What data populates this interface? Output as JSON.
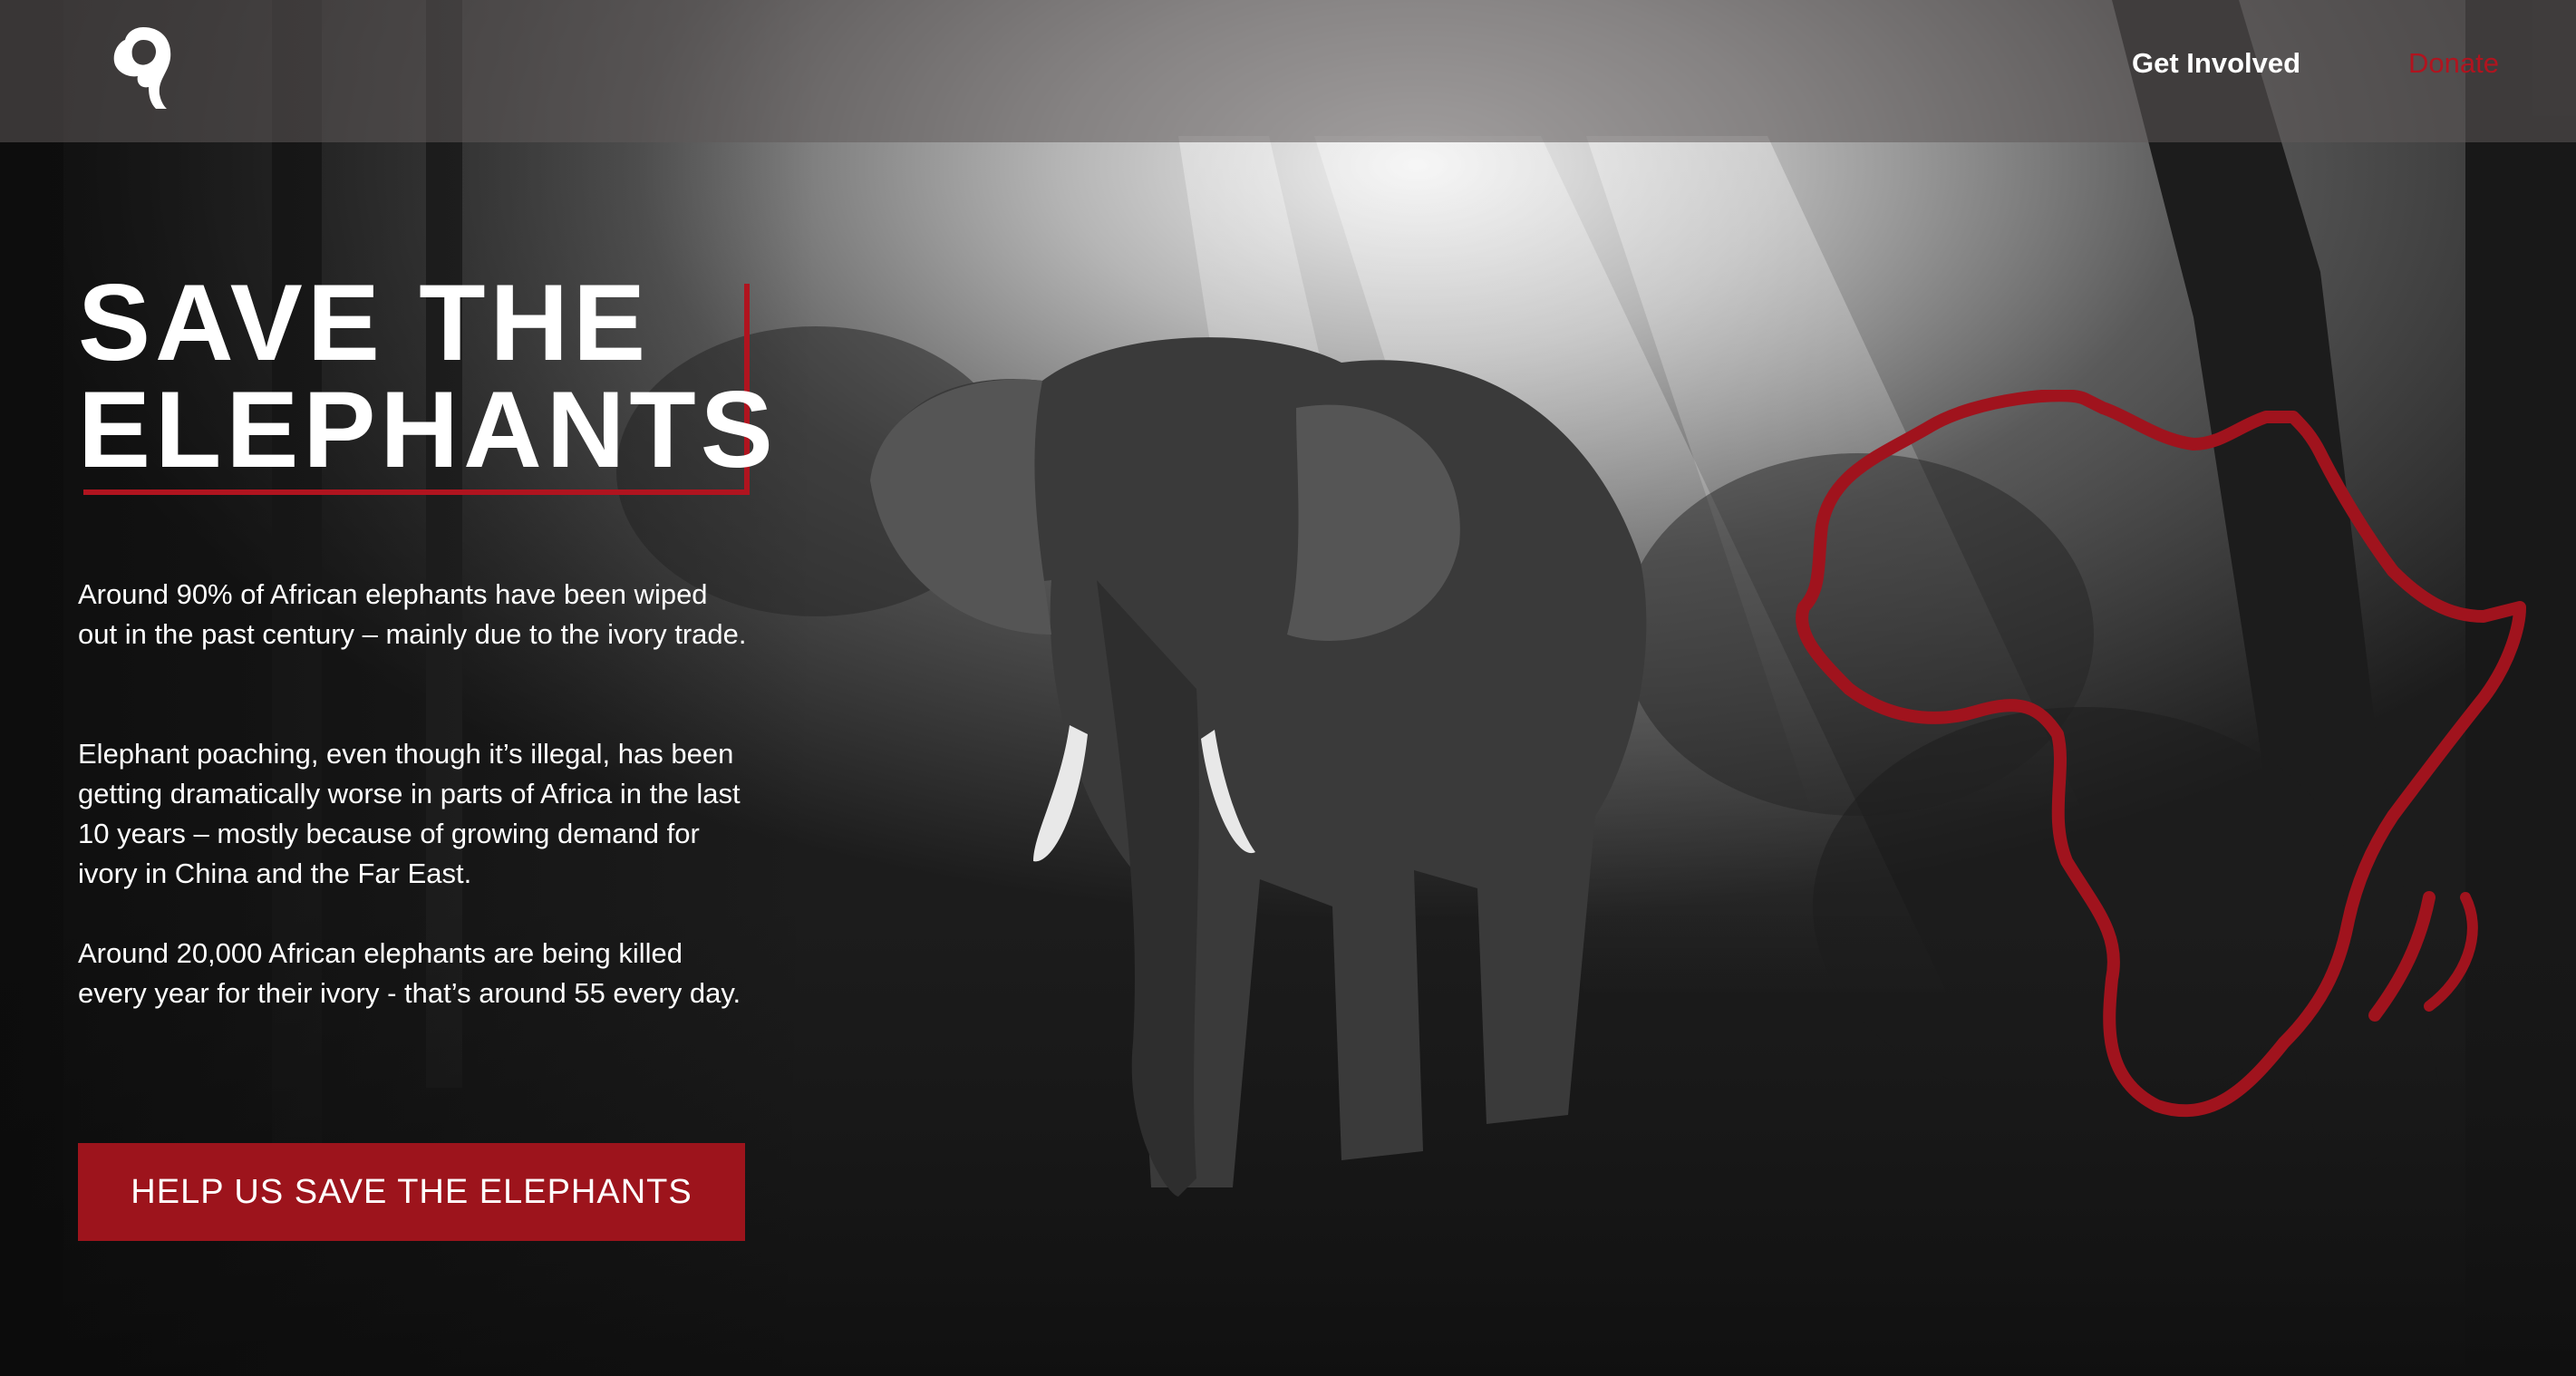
{
  "nav": {
    "logo_icon": "elephant-head-logo",
    "get_involved": "Get Involved",
    "donate": "Donate"
  },
  "hero": {
    "headline_line1": "SAVE THE",
    "headline_line2": "ELEPHANTS",
    "paragraphs": [
      "Around 90% of African elephants have been wiped out in the past century – mainly due to the ivory trade.",
      "Elephant poaching, even though it’s illegal, has been getting dramatically worse in parts of Africa in the last 10 years – mostly because of growing demand for ivory in China and the Far East.",
      "Around 20,000 African elephants are being killed every year for their ivory - that’s around 55 every day."
    ],
    "cta_label": "HELP US SAVE THE ELEPHANTS",
    "background_image": "black-and-white elephant in forest",
    "map_icon": "africa-outline-icon"
  },
  "colors": {
    "accent": "#b0141f",
    "cta_background": "#9d141c",
    "text": "#ffffff",
    "nav_background": "#5f5a5a"
  }
}
